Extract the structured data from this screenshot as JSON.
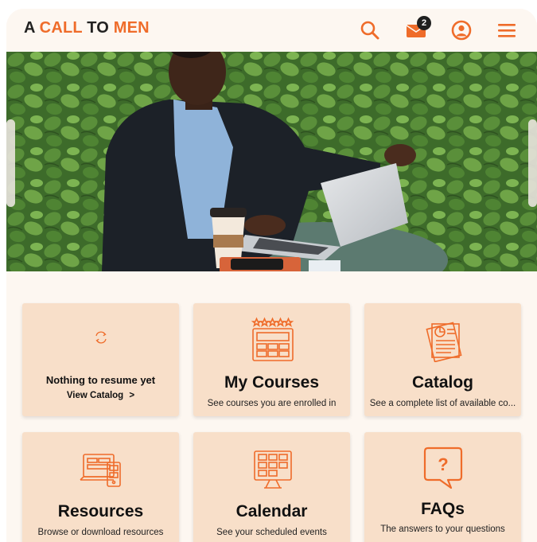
{
  "header": {
    "logo": {
      "a": "A",
      "call": "CALL",
      "to": "TO",
      "men": "MEN"
    },
    "icons": [
      "search-icon",
      "mail-icon",
      "user-circle-icon",
      "hamburger-menu-icon"
    ],
    "mail_badge": "2"
  },
  "hero": {
    "alt": "Man in a suit working on a laptop at an outdoor table in front of ivy"
  },
  "cards": {
    "resume": {
      "message": "Nothing to resume yet",
      "link": "View Catalog",
      "link_chevron": ">"
    },
    "my_courses": {
      "title": "My Courses",
      "subtitle": "See courses you are enrolled in"
    },
    "catalog": {
      "title": "Catalog",
      "subtitle": "See a complete list of available co..."
    },
    "resources": {
      "title": "Resources",
      "subtitle": "Browse or download resources"
    },
    "calendar": {
      "title": "Calendar",
      "subtitle": "See your scheduled events"
    },
    "faqs": {
      "title": "FAQs",
      "subtitle": "The answers to your questions"
    }
  },
  "colors": {
    "accent": "#ef6c2a",
    "card_bg": "#f8dfc9",
    "page_bg": "#fdf7f1",
    "text": "#111111"
  }
}
